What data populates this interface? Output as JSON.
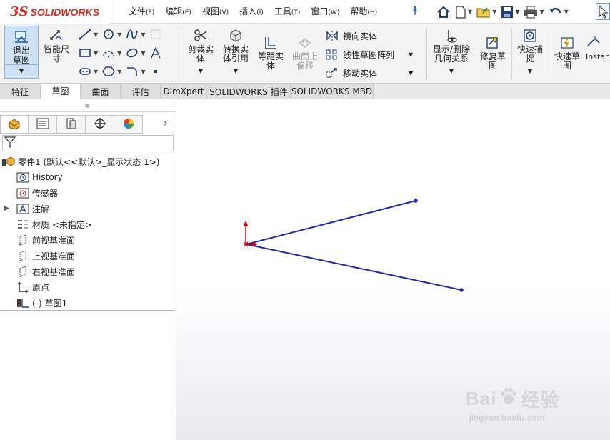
{
  "app": {
    "logo_mark": "3S",
    "logo_text": "SOLIDWORKS"
  },
  "menu": [
    {
      "label": "文件",
      "hotkey": "(F)"
    },
    {
      "label": "编辑",
      "hotkey": "(E)"
    },
    {
      "label": "视图",
      "hotkey": "(V)"
    },
    {
      "label": "插入",
      "hotkey": "(I)"
    },
    {
      "label": "工具",
      "hotkey": "(T)"
    },
    {
      "label": "窗口",
      "hotkey": "(W)"
    },
    {
      "label": "帮助",
      "hotkey": "(H)"
    }
  ],
  "quick_access": {
    "icons": [
      "home-icon",
      "new-document-icon",
      "open-icon",
      "save-icon",
      "print-icon",
      "undo-icon",
      "select-icon"
    ]
  },
  "commands": {
    "exit_sketch": "退出草图",
    "smart_dim": "智能尺寸",
    "trim": "剪裁实体",
    "convert": "转换实体引用",
    "offset": "等距实体",
    "surface_offset": "曲面上偏移",
    "mirror": "镜向实体",
    "linear_pattern": "线性草图阵列",
    "move": "移动实体",
    "relations": "显示/删除几何关系",
    "repair": "修复草图",
    "quick_snap": "快速捕捉",
    "rapid_sketch": "快速草图",
    "instant": "Instan"
  },
  "tabs": [
    {
      "label": "特征",
      "active": false
    },
    {
      "label": "草图",
      "active": true
    },
    {
      "label": "曲面",
      "active": false
    },
    {
      "label": "评估",
      "active": false
    },
    {
      "label": "DimXpert",
      "active": false
    },
    {
      "label": "SOLIDWORKS 插件",
      "active": false
    },
    {
      "label": "SOLIDWORKS MBD",
      "active": false
    }
  ],
  "tree": {
    "root": "零件1  (默认<<默认>_显示状态 1>)",
    "history": "History",
    "sensors": "传感器",
    "annotations": "注解",
    "material": "材质 <未指定>",
    "front_plane": "前视基准面",
    "top_plane": "上视基准面",
    "right_plane": "右视基准面",
    "origin": "原点",
    "sketch": "(-) 草图1"
  },
  "watermark": {
    "title": "Bai",
    "title2": "经验",
    "url": "jingyan.baidu.com"
  },
  "colors": {
    "sketch_line": "#1e2aa8",
    "origin_red": "#d40000",
    "accent_blue": "#1e3f7a"
  }
}
